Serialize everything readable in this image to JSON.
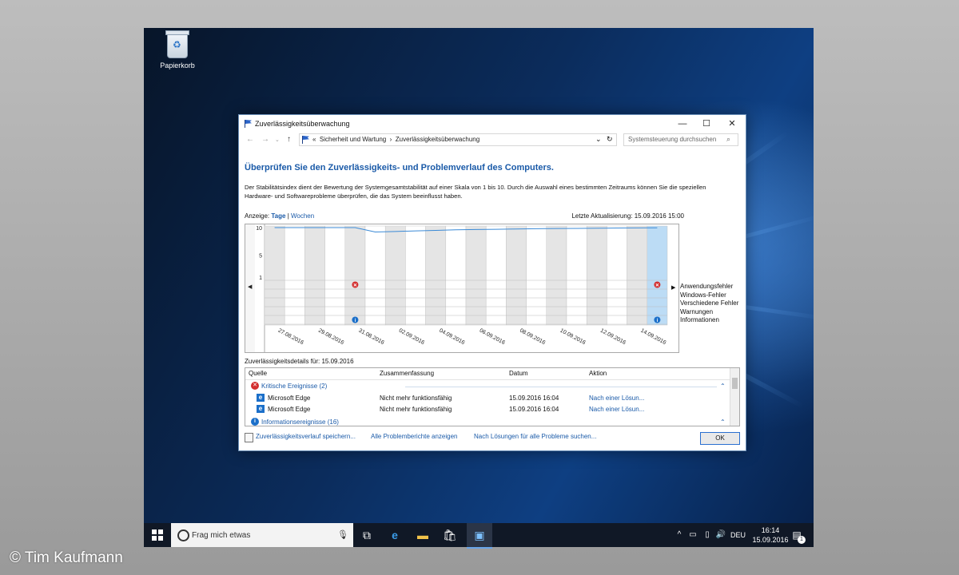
{
  "desktop": {
    "recycle_bin_label": "Papierkorb"
  },
  "window": {
    "title": "Zuverlässigkeitsüberwachung",
    "address": {
      "prefix": "«",
      "crumb1": "Sicherheit und Wartung",
      "crumb2": "Zuverlässigkeitsüberwachung"
    },
    "search_placeholder": "Systemsteuerung durchsuchen",
    "heading": "Überprüfen Sie den Zuverlässigkeits- und Problemverlauf des Computers.",
    "description": "Der Stabilitätsindex dient der Bewertung der Systemgesamtstabilität auf einer Skala von 1 bis 10. Durch die Auswahl eines bestimmten Zeitraums können Sie die speziellen Hardware- und Softwareprobleme überprüfen, die das System beeinflusst haben.",
    "view_label": "Anzeige:",
    "view_days": "Tage",
    "view_sep": "|",
    "view_weeks": "Wochen",
    "last_update": "Letzte Aktualisierung: 15.09.2016 15:00",
    "details_label": "Zuverlässigkeitsdetails für: 15.09.2016",
    "footer": {
      "save_link": "Zuverlässigkeitsverlauf speichern...",
      "reports_link": "Alle Problemberichte anzeigen",
      "solutions_link": "Nach Lösungen für alle Probleme suchen...",
      "ok": "OK"
    }
  },
  "chart_data": {
    "type": "line",
    "y_ticks": [
      "10",
      "5",
      "1"
    ],
    "x_labels": [
      "27.08.2016",
      "29.08.2016",
      "31.08.2016",
      "02.09.2016",
      "04.09.2016",
      "06.09.2016",
      "08.09.2016",
      "10.09.2016",
      "12.09.2016",
      "14.09.2016"
    ],
    "day_count": 20,
    "stability": [
      10,
      10,
      10,
      10,
      10,
      9.2,
      9.3,
      9.4,
      9.5,
      9.6,
      9.65,
      9.7,
      9.75,
      9.8,
      9.83,
      9.86,
      9.9,
      9.92,
      9.95,
      9.97
    ],
    "categories": [
      "Anwendungsfehler",
      "Windows-Fehler",
      "Verschiedene Fehler",
      "Warnungen",
      "Informationen"
    ],
    "events": [
      {
        "day": 4,
        "category": 0,
        "kind": "error"
      },
      {
        "day": 19,
        "category": 0,
        "kind": "error"
      },
      {
        "day": 4,
        "category": 4,
        "kind": "info"
      },
      {
        "day": 19,
        "category": 4,
        "kind": "info"
      }
    ],
    "selected_day": 19,
    "line_color": "#3b8ad6"
  },
  "details": {
    "columns": [
      "Quelle",
      "Zusammenfassung",
      "Datum",
      "Aktion"
    ],
    "group_critical": "Kritische Ereignisse (2)",
    "rows": [
      {
        "source": "Microsoft Edge",
        "summary": "Nicht mehr funktionsfähig",
        "date": "15.09.2016 16:04",
        "action": "Nach einer Lösun..."
      },
      {
        "source": "Microsoft Edge",
        "summary": "Nicht mehr funktionsfähig",
        "date": "15.09.2016 16:04",
        "action": "Nach einer Lösun..."
      }
    ],
    "group_info": "Informationsereignisse (16)"
  },
  "taskbar": {
    "search_text": "Frag mich etwas",
    "language": "DEU",
    "time": "16:14",
    "date": "15.09.2016",
    "notifications": "1"
  },
  "watermark": "© Tim Kaufmann"
}
